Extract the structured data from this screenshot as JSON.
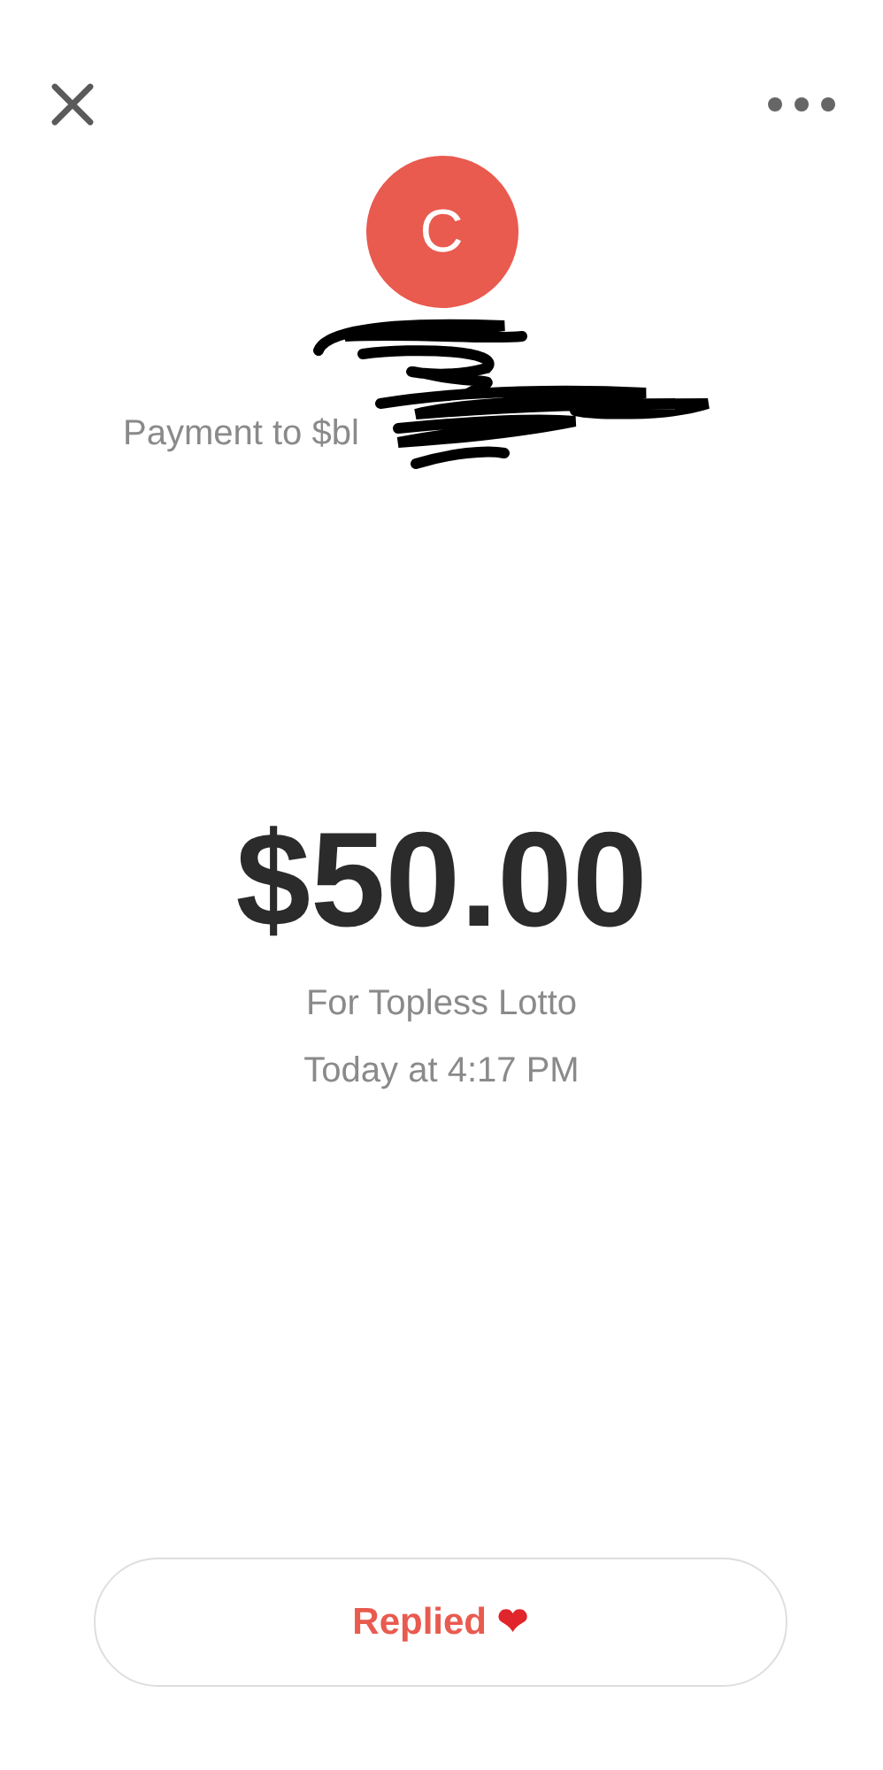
{
  "avatar": {
    "initial": "C",
    "color": "#e95a4f"
  },
  "payment_line": "Payment to $bl",
  "redacted": true,
  "amount": "$50.00",
  "note": "For Topless Lotto",
  "time": "Today at 4:17 PM",
  "reply_button": {
    "label": "Replied",
    "emoji": "❤"
  }
}
